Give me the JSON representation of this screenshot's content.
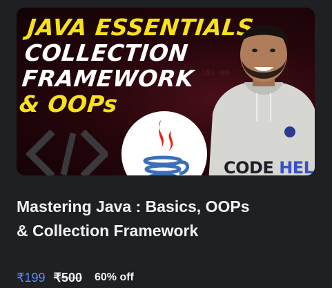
{
  "thumbnail": {
    "headline_lines": [
      "JAVA ESSENTIALS,",
      "COLLECTION",
      "FRAMEWORK",
      "& OOPs"
    ],
    "brand_text_1": "CODE",
    "brand_text_2": "HELP",
    "icon": "java-logo-icon"
  },
  "course": {
    "title_line1": "Mastering Java : Basics, OOPs",
    "title_line2": "& Collection Framework",
    "price_current": "₹199",
    "price_original": "₹500",
    "discount": "60% off"
  },
  "colors": {
    "headline_yellow": "#f7e11a",
    "price_blue": "#5f8bff",
    "card_bg": "#1f2023",
    "thumb_maroon": "#4a0f1a"
  }
}
